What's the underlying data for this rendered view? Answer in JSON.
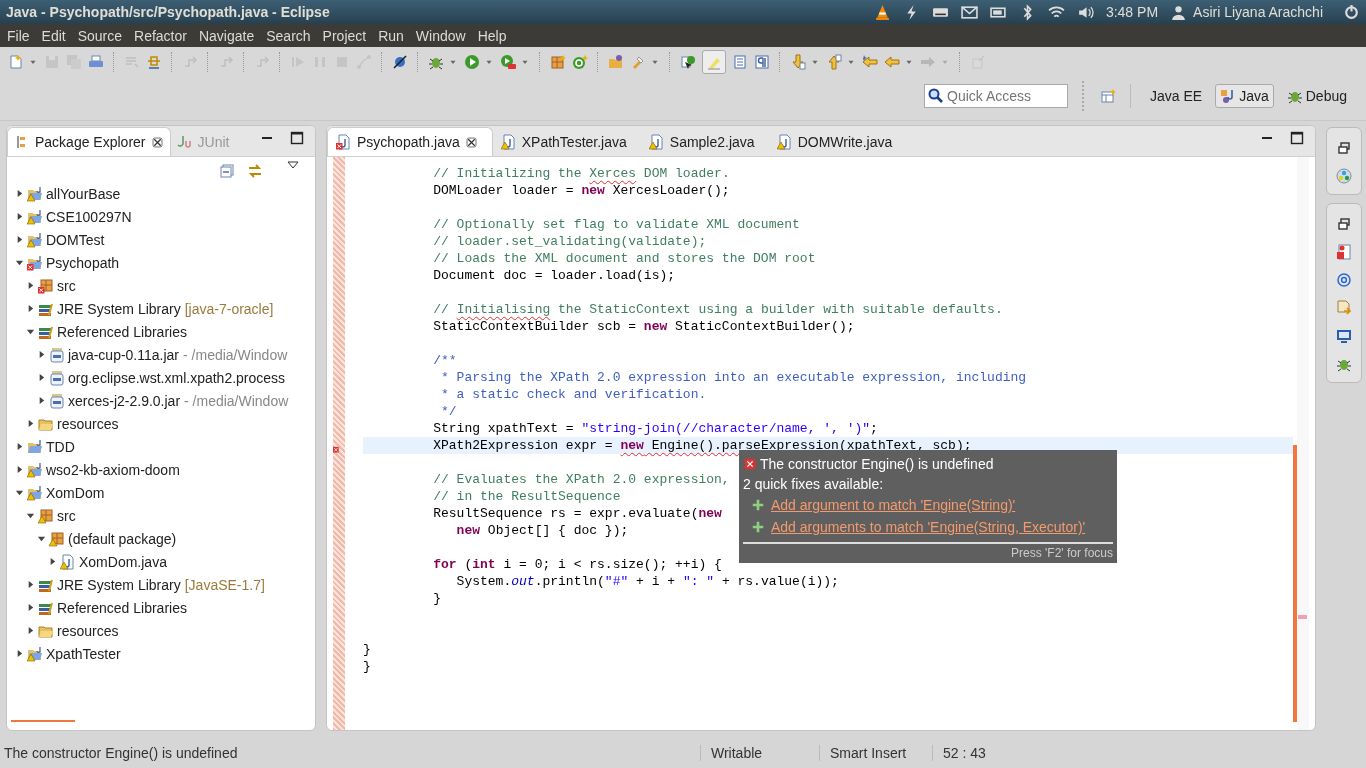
{
  "top_panel": {
    "title": "Java - Psychopath/src/Psychopath.java - Eclipse",
    "time": "3:48 PM",
    "user": "Asiri Liyana Arachchi"
  },
  "menu": [
    "File",
    "Edit",
    "Source",
    "Refactor",
    "Navigate",
    "Search",
    "Project",
    "Run",
    "Window",
    "Help"
  ],
  "quick_access": {
    "placeholder": "Quick Access"
  },
  "perspectives": [
    {
      "label": "Java EE",
      "kind": "plain",
      "selected": false
    },
    {
      "label": "Java",
      "kind": "java",
      "selected": true
    },
    {
      "label": "Debug",
      "kind": "debug",
      "selected": false
    }
  ],
  "package_explorer": {
    "tabs": [
      {
        "label": "Package Explorer",
        "kind": "packages",
        "selected": true
      },
      {
        "label": "JUnit",
        "kind": "junit",
        "selected": false
      }
    ],
    "tree": [
      {
        "label": "allYourBase",
        "kind": "project",
        "warning": true,
        "error": false,
        "expanded": false
      },
      {
        "label": "CSE100297N",
        "kind": "project",
        "warning": true,
        "error": false,
        "expanded": false
      },
      {
        "label": "DOMTest",
        "kind": "project",
        "warning": true,
        "error": false,
        "expanded": false
      },
      {
        "label": "Psychopath",
        "kind": "project",
        "warning": false,
        "error": true,
        "expanded": true,
        "children": [
          {
            "label": "src",
            "kind": "src",
            "warning": false,
            "error": true,
            "expanded": false
          },
          {
            "label": "JRE System Library",
            "detail": "[java-7-oracle]",
            "kind": "library",
            "warning": false,
            "error": false,
            "expanded": false
          },
          {
            "label": "Referenced Libraries",
            "kind": "library",
            "warning": false,
            "error": false,
            "expanded": true,
            "children": [
              {
                "label": "java-cup-0.11a.jar",
                "detail": "- /media/Window",
                "kind": "jar",
                "warning": false,
                "error": false,
                "expanded": false
              },
              {
                "label": "org.eclipse.wst.xml.xpath2.process",
                "kind": "jar",
                "warning": false,
                "error": false,
                "expanded": false
              },
              {
                "label": "xerces-j2-2.9.0.jar",
                "detail": "- /media/Window",
                "kind": "jar",
                "warning": false,
                "error": false,
                "expanded": false
              }
            ]
          },
          {
            "label": "resources",
            "kind": "folder",
            "warning": false,
            "error": false,
            "expanded": false
          }
        ]
      },
      {
        "label": "TDD",
        "kind": "project",
        "warning": false,
        "error": false,
        "expanded": false
      },
      {
        "label": "wso2-kb-axiom-doom",
        "kind": "project",
        "warning": true,
        "error": false,
        "expanded": false
      },
      {
        "label": "XomDom",
        "kind": "project",
        "warning": true,
        "error": false,
        "expanded": true,
        "children": [
          {
            "label": "src",
            "kind": "src",
            "warning": true,
            "error": false,
            "expanded": true,
            "children": [
              {
                "label": "(default package)",
                "kind": "package",
                "warning": true,
                "error": false,
                "expanded": true,
                "children": [
                  {
                    "label": "XomDom.java",
                    "kind": "java",
                    "warning": true,
                    "error": false,
                    "expanded": false
                  }
                ]
              }
            ]
          },
          {
            "label": "JRE System Library",
            "detail": "[JavaSE-1.7]",
            "kind": "library",
            "warning": false,
            "error": false,
            "expanded": false
          },
          {
            "label": "Referenced Libraries",
            "kind": "library",
            "warning": false,
            "error": false,
            "expanded": false
          },
          {
            "label": "resources",
            "kind": "folder",
            "warning": false,
            "error": false,
            "expanded": false
          }
        ]
      },
      {
        "label": "XpathTester",
        "kind": "project",
        "warning": true,
        "error": false,
        "expanded": false
      }
    ]
  },
  "editor": {
    "tabs": [
      {
        "label": "Psychopath.java",
        "warning": false,
        "error": true,
        "selected": true
      },
      {
        "label": "XPathTester.java",
        "warning": true,
        "error": false,
        "selected": false
      },
      {
        "label": "Sample2.java",
        "warning": true,
        "error": false,
        "selected": false
      },
      {
        "label": "DOMWrite.java",
        "warning": true,
        "error": false,
        "selected": false
      }
    ],
    "lines": [
      {
        "kind": "code",
        "tokens": [
          {
            "t": "         // Initializing the ",
            "kind": "comment"
          },
          {
            "t": "Xerces",
            "kind": "comment",
            "sq": true
          },
          {
            "t": " DOM loader.",
            "kind": "comment"
          }
        ]
      },
      {
        "kind": "code",
        "tokens": [
          {
            "t": "         DOMLoader loader = ",
            "kind": "code"
          },
          {
            "t": "new",
            "kind": "keyword"
          },
          {
            "t": " XercesLoader();",
            "kind": "code"
          }
        ]
      },
      {
        "kind": "blank"
      },
      {
        "kind": "code",
        "tokens": [
          {
            "t": "         // Optionally set flag to validate XML document",
            "kind": "comment"
          }
        ]
      },
      {
        "kind": "code",
        "tokens": [
          {
            "t": "         // loader.set_validating(validate);",
            "kind": "comment"
          }
        ]
      },
      {
        "kind": "code",
        "tokens": [
          {
            "t": "         // Loads the XML document and stores the DOM root",
            "kind": "comment"
          }
        ]
      },
      {
        "kind": "code",
        "tokens": [
          {
            "t": "         Document doc = loader.load(is);",
            "kind": "code"
          }
        ]
      },
      {
        "kind": "blank"
      },
      {
        "kind": "code",
        "tokens": [
          {
            "t": "         // ",
            "kind": "comment"
          },
          {
            "t": "Initialising",
            "kind": "comment",
            "sq": true
          },
          {
            "t": " the StaticContext using a builder with suitable defaults.",
            "kind": "comment"
          }
        ]
      },
      {
        "kind": "code",
        "tokens": [
          {
            "t": "         StaticContextBuilder scb = ",
            "kind": "code"
          },
          {
            "t": "new",
            "kind": "keyword"
          },
          {
            "t": " StaticContextBuilder();",
            "kind": "code"
          }
        ]
      },
      {
        "kind": "blank"
      },
      {
        "kind": "code",
        "tokens": [
          {
            "t": "         /**",
            "kind": "javadoc"
          }
        ]
      },
      {
        "kind": "code",
        "tokens": [
          {
            "t": "          * Parsing the XPath 2.0 expression into an executable expression, including",
            "kind": "javadoc"
          }
        ]
      },
      {
        "kind": "code",
        "tokens": [
          {
            "t": "          * a static check and verification.",
            "kind": "javadoc"
          }
        ]
      },
      {
        "kind": "code",
        "tokens": [
          {
            "t": "          */",
            "kind": "javadoc"
          }
        ]
      },
      {
        "kind": "code",
        "tokens": [
          {
            "t": "         String xpathText = ",
            "kind": "code"
          },
          {
            "t": "\"string-join(//character/name, ', ')\"",
            "kind": "string"
          },
          {
            "t": ";",
            "kind": "code"
          }
        ]
      },
      {
        "kind": "code",
        "current": true,
        "error": true,
        "tokens": [
          {
            "t": "         XPath2Expression expr = ",
            "kind": "code"
          },
          {
            "t": "new",
            "kind": "keyword",
            "sq": true
          },
          {
            "t": " Engine().parseExpression",
            "kind": "code",
            "sq": true
          },
          {
            "t": "(xpathText, scb);",
            "kind": "code"
          }
        ]
      },
      {
        "kind": "blank"
      },
      {
        "kind": "code",
        "tokens": [
          {
            "t": "         // Evaluates the XPath 2.0 expression,",
            "kind": "comment"
          }
        ]
      },
      {
        "kind": "code",
        "tokens": [
          {
            "t": "         // in the ResultSequence",
            "kind": "comment"
          }
        ]
      },
      {
        "kind": "code",
        "tokens": [
          {
            "t": "         ResultSequence rs = expr.evaluate(",
            "kind": "code"
          },
          {
            "t": "new",
            "kind": "keyword"
          }
        ]
      },
      {
        "kind": "code",
        "tokens": [
          {
            "t": "            new",
            "kind": "keyword"
          },
          {
            "t": " Object[] { doc });",
            "kind": "code"
          }
        ]
      },
      {
        "kind": "blank"
      },
      {
        "kind": "code",
        "tokens": [
          {
            "t": "         for",
            "kind": "keyword"
          },
          {
            "t": " (",
            "kind": "code"
          },
          {
            "t": "int",
            "kind": "keyword"
          },
          {
            "t": " i = 0; i < rs.size(); ++i) {",
            "kind": "code"
          }
        ]
      },
      {
        "kind": "code",
        "tokens": [
          {
            "t": "            System.",
            "kind": "code"
          },
          {
            "t": "out",
            "kind": "field"
          },
          {
            "t": ".println(",
            "kind": "code"
          },
          {
            "t": "\"#\"",
            "kind": "string"
          },
          {
            "t": " + i + ",
            "kind": "code"
          },
          {
            "t": "\": \"",
            "kind": "string"
          },
          {
            "t": " + rs.value(i));",
            "kind": "code"
          }
        ]
      },
      {
        "kind": "code",
        "tokens": [
          {
            "t": "         }",
            "kind": "code"
          }
        ]
      },
      {
        "kind": "blank"
      },
      {
        "kind": "blank"
      },
      {
        "kind": "code",
        "tokens": [
          {
            "t": "}",
            "kind": "code"
          }
        ]
      },
      {
        "kind": "code",
        "tokens": [
          {
            "t": "}",
            "kind": "code"
          }
        ]
      }
    ],
    "hover": {
      "title": "The constructor Engine() is undefined",
      "subtitle": "2 quick fixes available:",
      "fixes": [
        "Add argument to match 'Engine(String)'",
        "Add arguments to match 'Engine(String, Executor)'"
      ],
      "footer": "Press 'F2' for focus"
    }
  },
  "status_bar": {
    "message": "The constructor Engine() is undefined",
    "mode": "Writable",
    "insert": "Smart Insert",
    "position": "52 : 43"
  }
}
